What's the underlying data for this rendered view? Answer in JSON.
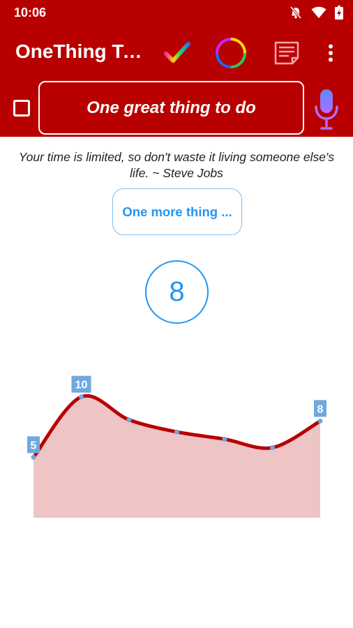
{
  "status": {
    "time": "10:06"
  },
  "toolbar": {
    "title": "OneThing To..."
  },
  "task": {
    "text": "One great thing to do"
  },
  "quote": {
    "text": "Your time is limited, so don't waste it living someone else's life. ~ Steve Jobs"
  },
  "more_button": {
    "label": "One more thing ..."
  },
  "counter": {
    "value": "8"
  },
  "colors": {
    "brand": "#b80000",
    "accent": "#2196f3",
    "line": "#b80000",
    "fill": "#eec4c4",
    "point": "#6fa8dc"
  },
  "icons": [
    "bell-off-icon",
    "wifi-icon",
    "battery-icon",
    "checkmark-icon",
    "color-ring-icon",
    "notes-icon",
    "overflow-menu-icon",
    "microphone-icon"
  ],
  "chart_data": {
    "type": "area",
    "x": [
      1,
      2,
      3,
      4,
      5,
      6,
      7
    ],
    "values": [
      5,
      10,
      8.1,
      7.1,
      6.5,
      5.8,
      8
    ],
    "point_labels": [
      "5",
      "10",
      "",
      "",
      "",
      "",
      "8"
    ],
    "ylim": [
      0,
      12
    ],
    "grid": false
  }
}
